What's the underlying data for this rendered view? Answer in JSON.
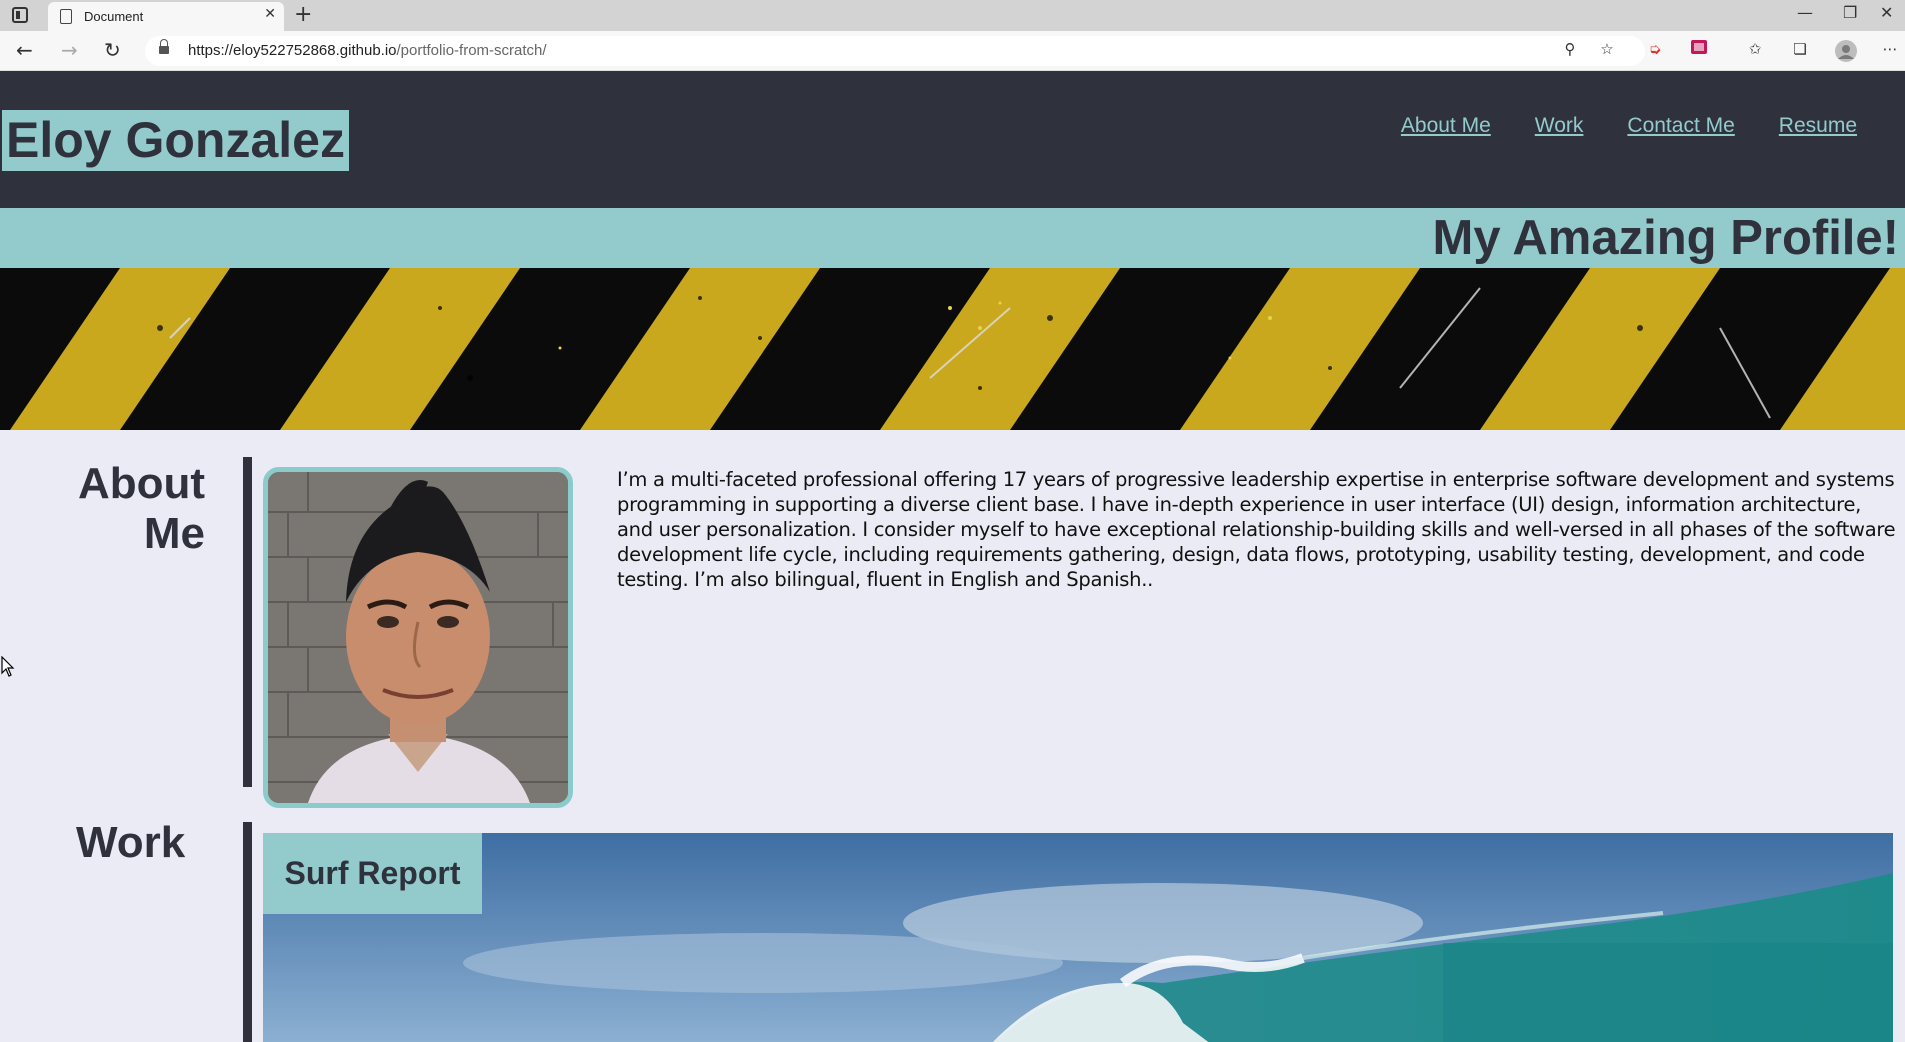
{
  "browser": {
    "tab_title": "Document",
    "url_host": "https://eloy522752868.github.io",
    "url_path": "/portfolio-from-scratch/"
  },
  "header": {
    "name": "Eloy Gonzalez",
    "nav": [
      "About Me",
      "Work",
      "Contact Me",
      "Resume"
    ]
  },
  "hero": {
    "title": "My Amazing Profile!"
  },
  "about": {
    "heading": "About Me",
    "text": "I’m a multi-faceted professional offering 17 years of progressive leadership expertise in enterprise software development and systems programming in supporting a diverse client base. I have in-depth experience in user interface (UI) design, information architecture, and user personalization. I consider myself to have exceptional relationship-building skills and well-versed in all phases of the software development life cycle, including requirements gathering, design, data flows, prototyping, usability testing, development, and code testing. I’m also bilingual, fluent in English and Spanish.."
  },
  "work": {
    "heading": "Work",
    "projects": [
      {
        "title": "Surf Report"
      }
    ]
  },
  "colors": {
    "header_bg": "#2f323d",
    "accent": "#93cbcc",
    "page_bg": "#ebebf5"
  },
  "icons": [
    "tab-actions-icon",
    "page-icon",
    "close-icon",
    "plus-icon",
    "back-icon",
    "forward-icon",
    "refresh-icon",
    "lock-icon",
    "zoom-icon",
    "favorite-add-icon",
    "extension-icon",
    "coupon-icon",
    "favorites-icon",
    "collections-icon",
    "profile-icon",
    "more-icon",
    "minimize-icon",
    "restore-icon",
    "window-close-icon"
  ]
}
